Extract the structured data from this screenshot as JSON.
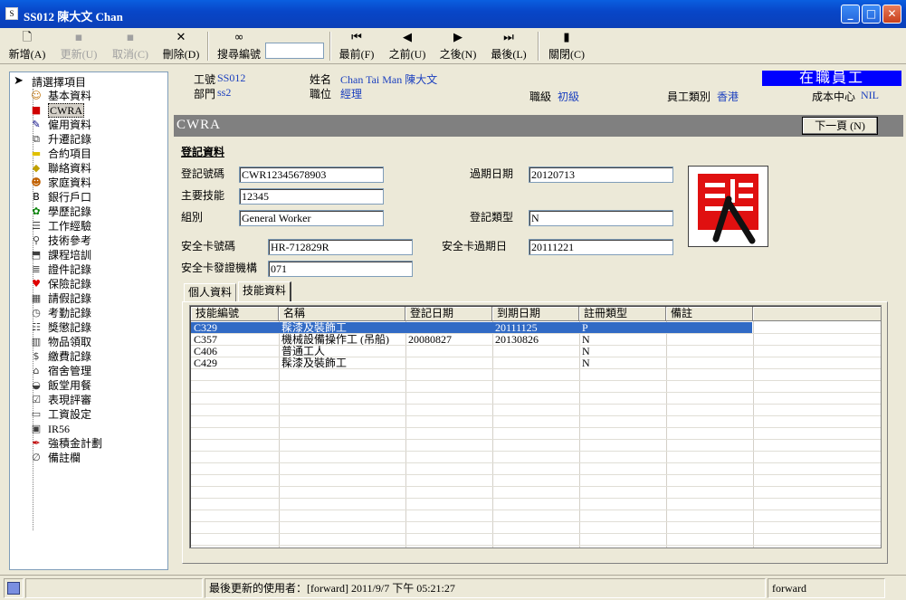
{
  "window": {
    "title": "SS012 陳大文 Chan",
    "icon_glyph": "S"
  },
  "toolbar": {
    "new": "新增(A)",
    "update": "更新(U)",
    "cancel": "取消(C)",
    "delete": "刪除(D)",
    "search": "搜尋編號",
    "search_value": "",
    "first": "最前(F)",
    "prev": "之前(U)",
    "next": "之後(N)",
    "last": "最後(L)",
    "close": "關閉(C)"
  },
  "tree": {
    "root": "請選擇項目",
    "items": [
      {
        "label": "基本資料",
        "icon": "person-icon",
        "glyph": "☺",
        "color": "#c07000"
      },
      {
        "label": "CWRA",
        "icon": "cwra-icon",
        "glyph": "■",
        "color": "#d00000"
      },
      {
        "label": "僱用資料",
        "icon": "employ-icon",
        "glyph": "✎",
        "color": "#000080"
      },
      {
        "label": "升遷記錄",
        "icon": "promotion-icon",
        "glyph": "⧉",
        "color": "#404040"
      },
      {
        "label": "合約項目",
        "icon": "folder-icon",
        "glyph": "▬",
        "color": "#e0c000"
      },
      {
        "label": "聯絡資料",
        "icon": "contact-icon",
        "glyph": "◆",
        "color": "#c0a000"
      },
      {
        "label": "家庭資料",
        "icon": "family-icon",
        "glyph": "☻",
        "color": "#c06000"
      },
      {
        "label": "銀行戶口",
        "icon": "bank-icon",
        "glyph": "B",
        "color": "#000000"
      },
      {
        "label": "學歷記錄",
        "icon": "education-icon",
        "glyph": "✿",
        "color": "#008000"
      },
      {
        "label": "工作經驗",
        "icon": "experience-icon",
        "glyph": "☰",
        "color": "#404040"
      },
      {
        "label": "技術參考",
        "icon": "search-icon",
        "glyph": "⚲",
        "color": "#404040"
      },
      {
        "label": "課程培訓",
        "icon": "course-icon",
        "glyph": "⬒",
        "color": "#404040"
      },
      {
        "label": "證件記錄",
        "icon": "document-icon",
        "glyph": "≣",
        "color": "#404040"
      },
      {
        "label": "保險記錄",
        "icon": "heart-icon",
        "glyph": "♥",
        "color": "#e00000"
      },
      {
        "label": "請假記錄",
        "icon": "leave-icon",
        "glyph": "▦",
        "color": "#404040"
      },
      {
        "label": "考勤記錄",
        "icon": "clock-icon",
        "glyph": "◷",
        "color": "#404040"
      },
      {
        "label": "獎懲記錄",
        "icon": "award-icon",
        "glyph": "☷",
        "color": "#404040"
      },
      {
        "label": "物品領取",
        "icon": "item-icon",
        "glyph": "▥",
        "color": "#404040"
      },
      {
        "label": "繳費記錄",
        "icon": "payment-icon",
        "glyph": "$",
        "color": "#404040"
      },
      {
        "label": "宿舍管理",
        "icon": "house-icon",
        "glyph": "⌂",
        "color": "#404040"
      },
      {
        "label": "飯堂用餐",
        "icon": "meal-icon",
        "glyph": "◒",
        "color": "#404040"
      },
      {
        "label": "表現評審",
        "icon": "checklist-icon",
        "glyph": "☑",
        "color": "#404040"
      },
      {
        "label": "工資設定",
        "icon": "salary-icon",
        "glyph": "▭",
        "color": "#404040"
      },
      {
        "label": "IR56",
        "icon": "disk-icon",
        "glyph": "▣",
        "color": "#404040"
      },
      {
        "label": "強積金計劃",
        "icon": "mpf-icon",
        "glyph": "✒",
        "color": "#c00000"
      },
      {
        "label": "備註欄",
        "icon": "paperclip-icon",
        "glyph": "∅",
        "color": "#404040"
      }
    ]
  },
  "header": {
    "emp_no_label": "工號",
    "emp_no": "SS012",
    "dept_label": "部門",
    "dept": "ss2",
    "name_label": "姓名",
    "name": "Chan Tai Man 陳大文",
    "position_label": "職位",
    "position": "經理",
    "grade_label": "職級",
    "grade": "初級",
    "category_label": "員工類別",
    "category": "香港",
    "cost_center_label": "成本中心",
    "cost_center": "NIL",
    "status": "在職員工"
  },
  "section": {
    "title": "CWRA",
    "next_page": "下一頁 (N)"
  },
  "form": {
    "heading": "登記資料",
    "reg_no_label": "登記號碼",
    "reg_no": "CWR12345678903",
    "expiry_label": "過期日期",
    "expiry": "20120713",
    "main_skill_label": "主要技能",
    "main_skill": "12345",
    "group_label": "組別",
    "group": "General Worker",
    "reg_type_label": "登記類型",
    "reg_type": "N",
    "safety_card_label": "安全卡號碼",
    "safety_card": "HR-712829R",
    "safety_expiry_label": "安全卡過期日",
    "safety_expiry": "20111221",
    "issuer_label": "安全卡發證機構",
    "issuer": "071"
  },
  "tabs": [
    "個人資料",
    "技能資料"
  ],
  "grid": {
    "columns": [
      "技能編號",
      "名稱",
      "登記日期",
      "到期日期",
      "註冊類型",
      "備註"
    ],
    "rows": [
      [
        "C329",
        "髹漆及裝飾工",
        "",
        "20111125",
        "P",
        ""
      ],
      [
        "C357",
        "機械設備操作工 (吊船)",
        "20080827",
        "20130826",
        "N",
        ""
      ],
      [
        "C406",
        "普通工人",
        "",
        "",
        "N",
        ""
      ],
      [
        "C429",
        "髹漆及裝飾工",
        "",
        "",
        "N",
        ""
      ]
    ]
  },
  "status": {
    "last_update": "最後更新的使用者：[forward]  2011/9/7 下午 05:21:27",
    "user": "forward"
  },
  "colors": {
    "title_bar": "#0a4fd4",
    "status_banner": "#0000ff",
    "section_bar": "#808080",
    "selection": "#316ac5",
    "value_text": "#1a3fbf"
  }
}
